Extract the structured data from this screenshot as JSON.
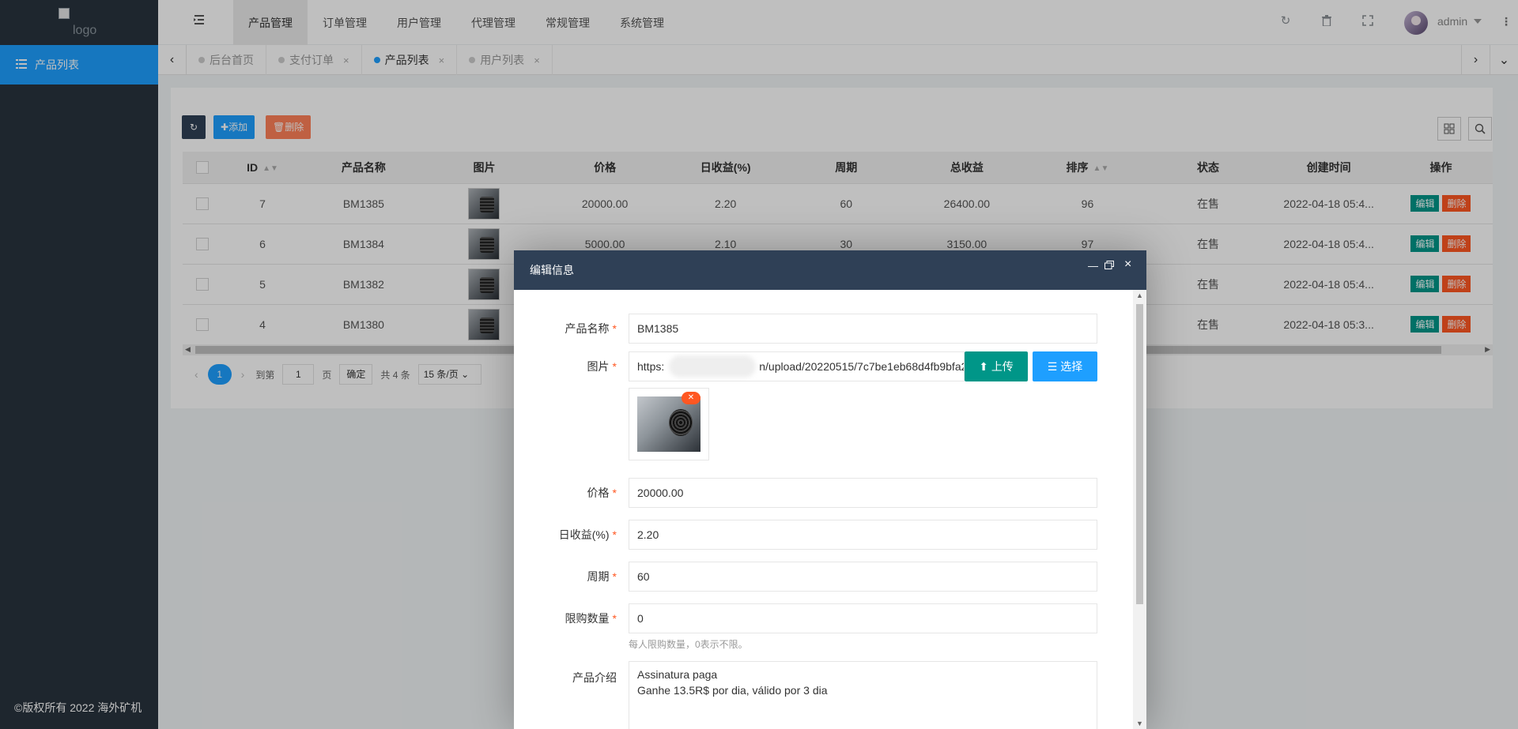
{
  "sidebar": {
    "logo_alt": "logo",
    "item_label": "产品列表",
    "copyright": "©版权所有 2022 海外矿机"
  },
  "header": {
    "nav": [
      "产品管理",
      "订单管理",
      "用户管理",
      "代理管理",
      "常规管理",
      "系统管理"
    ],
    "username": "admin"
  },
  "tabs": {
    "items": [
      {
        "label": "后台首页",
        "closable": false
      },
      {
        "label": "支付订单",
        "closable": true
      },
      {
        "label": "产品列表",
        "closable": true
      },
      {
        "label": "用户列表",
        "closable": true
      }
    ],
    "active": "产品列表"
  },
  "toolbar": {
    "add_label": "添加",
    "delete_label": "删除"
  },
  "table": {
    "columns": [
      "ID",
      "产品名称",
      "图片",
      "价格",
      "日收益(%)",
      "周期",
      "总收益",
      "排序",
      "状态",
      "创建时间",
      "操作"
    ],
    "rows": [
      {
        "id": "7",
        "name": "BM1385",
        "price": "20000.00",
        "daily": "2.20",
        "period": "60",
        "total": "26400.00",
        "sort": "96",
        "status": "在售",
        "created": "2022-04-18 05:4..."
      },
      {
        "id": "6",
        "name": "BM1384",
        "price": "5000.00",
        "daily": "2.10",
        "period": "30",
        "total": "3150.00",
        "sort": "97",
        "status": "在售",
        "created": "2022-04-18 05:4..."
      },
      {
        "id": "5",
        "name": "BM1382",
        "price": "",
        "daily": "",
        "period": "",
        "total": "",
        "sort": "",
        "status": "在售",
        "created": "2022-04-18 05:4..."
      },
      {
        "id": "4",
        "name": "BM1380",
        "price": "",
        "daily": "",
        "period": "",
        "total": "",
        "sort": "",
        "status": "在售",
        "created": "2022-04-18 05:3..."
      }
    ],
    "edit_label": "编辑",
    "delete_label": "删除"
  },
  "pager": {
    "current": "1",
    "goto_label": "到第",
    "goto_value": "1",
    "page_label": "页",
    "confirm_label": "确定",
    "total_label": "共 4 条",
    "per_page": "15 条/页"
  },
  "modal": {
    "title": "编辑信息",
    "fields": {
      "name_label": "产品名称",
      "name_value": "BM1385",
      "image_label": "图片",
      "image_url_prefix": "https:",
      "image_url_rest": "n/upload/20220515/7c7be1eb68d4fb9bfa23",
      "upload_label": "上传",
      "choose_label": "选择",
      "price_label": "价格",
      "price_value": "20000.00",
      "daily_label": "日收益(%)",
      "daily_value": "2.20",
      "period_label": "周期",
      "period_value": "60",
      "limit_label": "限购数量",
      "limit_value": "0",
      "limit_hint": "每人限购数量，0表示不限。",
      "intro_label": "产品介绍",
      "intro_line1": "Assinatura paga",
      "intro_line2": "Ganhe 13.5R$ por dia, válido por 3 dia"
    }
  },
  "colors": {
    "sidebar_bg": "#28333e",
    "accent_blue": "#1e9fff",
    "modal_header": "#2f4056",
    "green": "#009688",
    "danger": "#ff5722"
  }
}
